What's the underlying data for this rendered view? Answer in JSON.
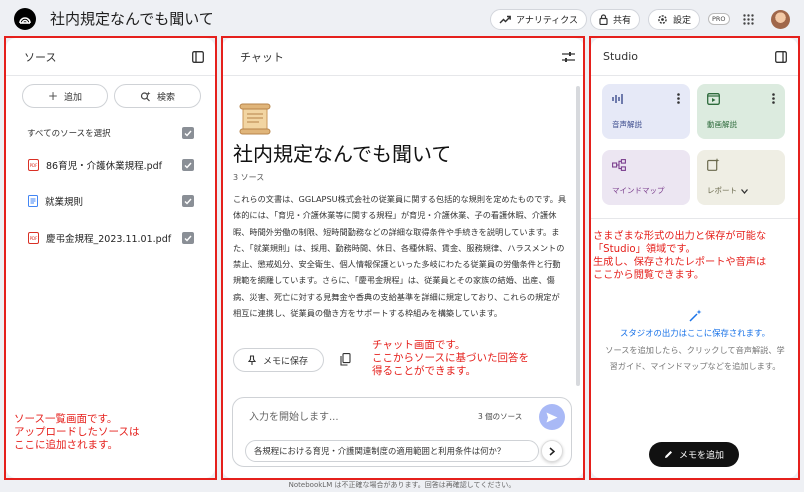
{
  "app": {
    "title": "社内規定なんでも聞いて"
  },
  "topbar": {
    "analytics": "アナリティクス",
    "share": "共有",
    "settings": "設定",
    "pro_badge": "PRO"
  },
  "sources_panel": {
    "title": "ソース",
    "add_label": "追加",
    "search_label": "検索",
    "select_all": "すべてのソースを選択",
    "items": [
      {
        "name": "86育児・介護休業規程.pdf",
        "type": "pdf-icon",
        "checked": true
      },
      {
        "name": "就業規則",
        "type": "doc-icon",
        "checked": true
      },
      {
        "name": "慶弔金規程_2023.11.01.pdf",
        "type": "pdf-icon",
        "checked": true
      }
    ],
    "annotation": "ソース一覧画面です。\nアップロードしたソースは\nここに追加されます。"
  },
  "chat_panel": {
    "title": "チャット",
    "heading": "社内規定なんでも聞いて",
    "source_count": "3 ソース",
    "summary": "これらの文書は、GGLAPSU株式会社の従業員に関する包括的な規則を定めたものです。具体的には、「育児・介護休業等に関する規程」が育児・介護休業、子の看護休暇、介護休暇、時間外労働の制限、短時間勤務などの詳細な取得条件や手続きを説明しています。また、「就業規則」は、採用、勤務時間、休日、各種休暇、賃金、服務規律、ハラスメントの禁止、懲戒処分、安全衛生、個人情報保護といった多岐にわたる従業員の労働条件と行動規範を網羅しています。さらに、「慶弔金規程」は、従業員とその家族の結婚、出産、傷病、災害、死亡に対する見舞金や香典の支給基準を詳細に規定しており、これらの規定が相互に連携し、従業員の働き方をサポートする枠組みを構築しています。",
    "save_note": "メモに保存",
    "input_placeholder": "入力を開始します...",
    "input_source_count": "3 個のソース",
    "suggestion": "各規程における育児・介護関連制度の適用範囲と利用条件は何か？",
    "annotation": "チャット画面です。\nここからソースに基づいた回答を\n得ることができます。"
  },
  "studio_panel": {
    "title": "Studio",
    "cards": [
      {
        "label": "音声解説",
        "icon": "audio-waveform-icon",
        "color": "#e6e9f7"
      },
      {
        "label": "動画解説",
        "icon": "video-player-icon",
        "color": "#dcebdf"
      },
      {
        "label": "マインドマップ",
        "icon": "mind-map-icon",
        "color": "#ece6f2"
      },
      {
        "label": "レポート",
        "icon": "report-icon",
        "color": "#efeee4"
      }
    ],
    "empty_title": "スタジオの出力はここに保存されます。",
    "empty_desc": "ソースを追加したら、クリックして音声解説、学習ガイド、マインドマップなどを追加します。",
    "add_note": "メモを追加",
    "annotation": "さまざまな形式の出力と保存が可能な\n「Studio」領域です。\n生成し、保存されたレポートや音声は\nここから閲覧できます。"
  },
  "footer": {
    "disclaimer": "NotebookLM は不正確な場合があります。回答は再確認してください。"
  },
  "colors": {
    "annotation": "#e5201c",
    "accent": "#1a73e8",
    "background": "#eef0f4"
  }
}
